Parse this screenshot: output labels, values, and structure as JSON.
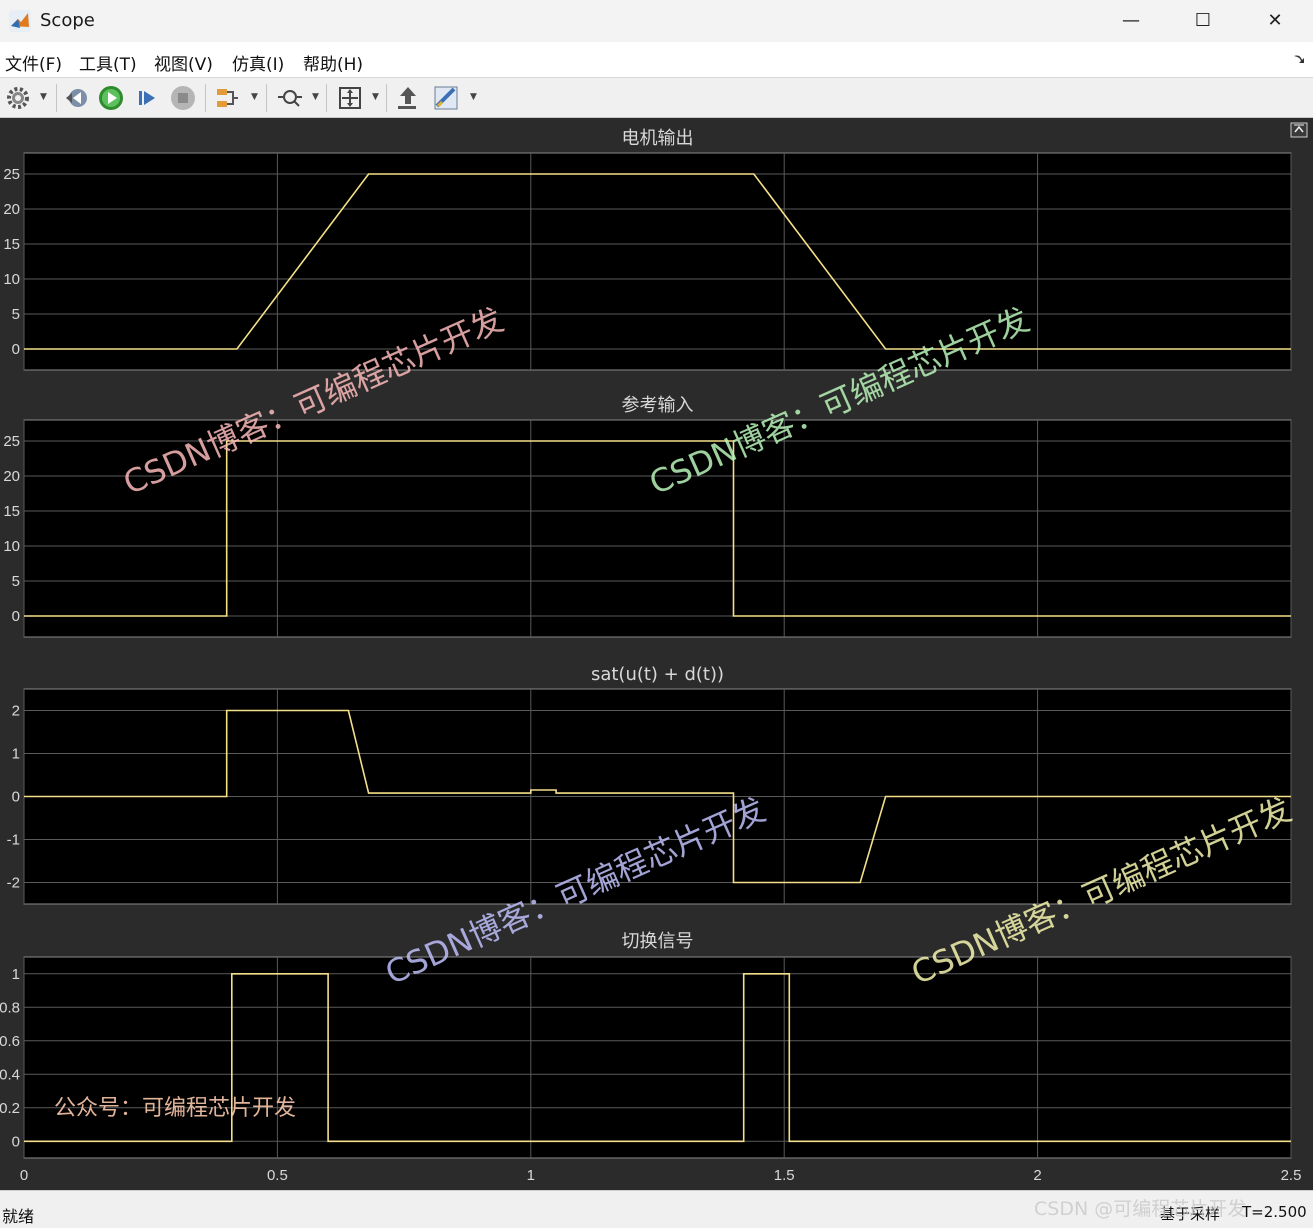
{
  "window": {
    "title": "Scope",
    "minimize": "—",
    "maximize": "☐",
    "close": "✕"
  },
  "menu": [
    {
      "label": "文件(F)"
    },
    {
      "label": "工具(T)"
    },
    {
      "label": "视图(V)"
    },
    {
      "label": "仿真(I)"
    },
    {
      "label": "帮助(H)"
    }
  ],
  "toolbar": {
    "icons": [
      "gear-icon",
      "step-back-icon",
      "run-icon",
      "step-forward-icon",
      "stop-icon",
      "signal-selector-icon",
      "zoom-icon",
      "autoscale-icon",
      "highlight-simulink-block-icon",
      "measurements-icon"
    ]
  },
  "colors": {
    "plot_bg": "#000000",
    "figure_bg": "#2b2b2b",
    "grid": "#5a5a5a",
    "axis_text": "#d8d8d8",
    "trace": "#f5e08a"
  },
  "chart_data": [
    {
      "type": "line",
      "title": "电机输出",
      "x": [
        0,
        0.42,
        0.68,
        1.44,
        1.7,
        2.5
      ],
      "series": [
        {
          "values": [
            0,
            0,
            25,
            25,
            0,
            0
          ]
        }
      ],
      "yticks": [
        "0",
        "5",
        "10",
        "15",
        "20",
        "25"
      ],
      "ylim": [
        -3,
        28
      ],
      "xlim": [
        0,
        2.5
      ],
      "grid": true
    },
    {
      "type": "line",
      "title": "参考输入",
      "x": [
        0,
        0.4,
        0.4,
        1.4,
        1.4,
        2.5
      ],
      "series": [
        {
          "values": [
            0,
            0,
            25,
            25,
            0,
            0
          ]
        }
      ],
      "yticks": [
        "0",
        "5",
        "10",
        "15",
        "20",
        "25"
      ],
      "ylim": [
        -3,
        28
      ],
      "xlim": [
        0,
        2.5
      ],
      "grid": true
    },
    {
      "type": "line",
      "title": "sat(u(t) + d(t))",
      "x": [
        0,
        0.4,
        0.4,
        0.64,
        0.68,
        1.0,
        1.0,
        1.05,
        1.05,
        1.4,
        1.4,
        1.65,
        1.7,
        2.5
      ],
      "series": [
        {
          "values": [
            0,
            0,
            2,
            2,
            0.08,
            0.08,
            0.15,
            0.15,
            0.08,
            0.08,
            -2,
            -2,
            0,
            0
          ]
        }
      ],
      "yticks": [
        "-2",
        "-1",
        "0",
        "1",
        "2"
      ],
      "ylim": [
        -2.5,
        2.5
      ],
      "xlim": [
        0,
        2.5
      ],
      "grid": true
    },
    {
      "type": "line",
      "title": "切换信号",
      "x": [
        0,
        0.41,
        0.41,
        0.6,
        0.6,
        1.42,
        1.42,
        1.51,
        1.51,
        2.5
      ],
      "series": [
        {
          "values": [
            0,
            0,
            1,
            1,
            0,
            0,
            1,
            1,
            0,
            0
          ]
        }
      ],
      "yticks": [
        "0",
        "0.2",
        "0.4",
        "0.6",
        "0.8",
        "1"
      ],
      "xticks": [
        "0",
        "0.5",
        "1",
        "1.5",
        "2",
        "2.5"
      ],
      "ylim": [
        -0.1,
        1.1
      ],
      "xlim": [
        0,
        2.5
      ],
      "grid": true
    }
  ],
  "watermarks": {
    "blog": "CSDN博客：可编程芯片开发",
    "wechat": "公众号：可编程芯片开发",
    "footer": "CSDN @可编程芯片开发"
  },
  "status": {
    "text": "就绪",
    "sample": "基于采样",
    "time": "T=2.500"
  }
}
